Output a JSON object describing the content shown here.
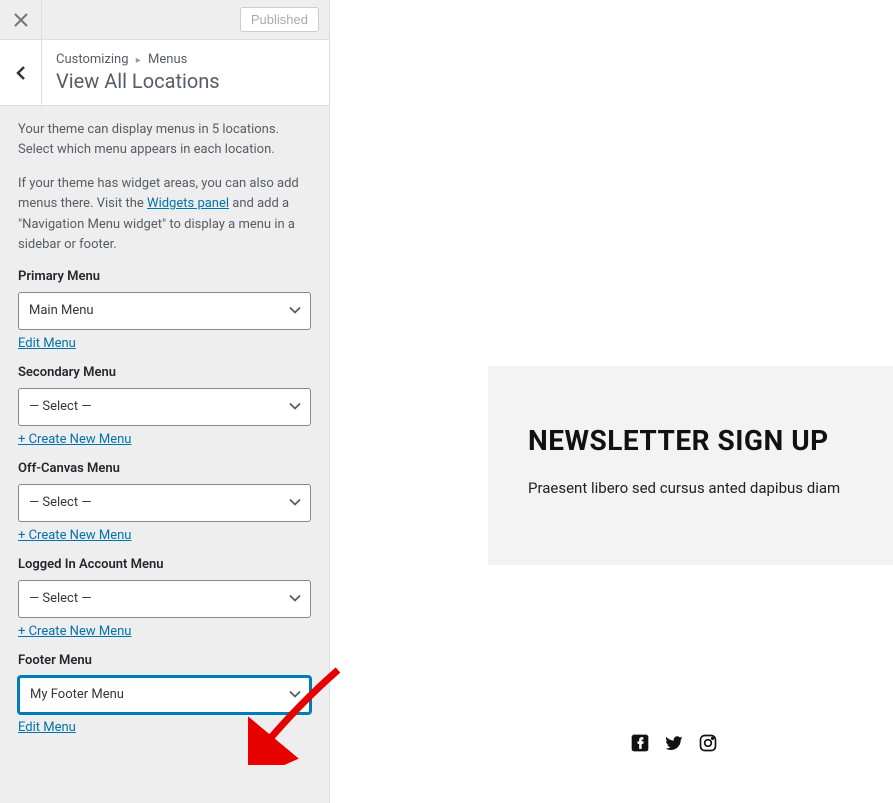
{
  "topbar": {
    "published_label": "Published"
  },
  "header": {
    "breadcrumb_parent": "Customizing",
    "breadcrumb_current": "Menus",
    "title": "View All Locations"
  },
  "descriptions": {
    "p1": "Your theme can display menus in 5 locations. Select which menu appears in each location.",
    "p2a": "If your theme has widget areas, you can also add menus there. Visit the ",
    "p2_link": "Widgets panel",
    "p2b": " and add a \"Navigation Menu widget\" to display a menu in a sidebar or footer."
  },
  "locations": [
    {
      "label": "Primary Menu",
      "value": "Main Menu",
      "action": "Edit Menu",
      "focused": false
    },
    {
      "label": "Secondary Menu",
      "value": "— Select —",
      "action": "+ Create New Menu",
      "focused": false
    },
    {
      "label": "Off-Canvas Menu",
      "value": "— Select —",
      "action": "+ Create New Menu",
      "focused": false
    },
    {
      "label": "Logged In Account Menu",
      "value": "— Select —",
      "action": "+ Create New Menu",
      "focused": false
    },
    {
      "label": "Footer Menu",
      "value": "My Footer Menu",
      "action": "Edit Menu",
      "focused": true
    }
  ],
  "preview": {
    "newsletter_title": "NEWSLETTER SIGN UP",
    "newsletter_sub": "Praesent libero sed cursus anted dapibus diam"
  },
  "icons": {
    "facebook": "facebook-icon",
    "twitter": "twitter-icon",
    "instagram": "instagram-icon"
  }
}
